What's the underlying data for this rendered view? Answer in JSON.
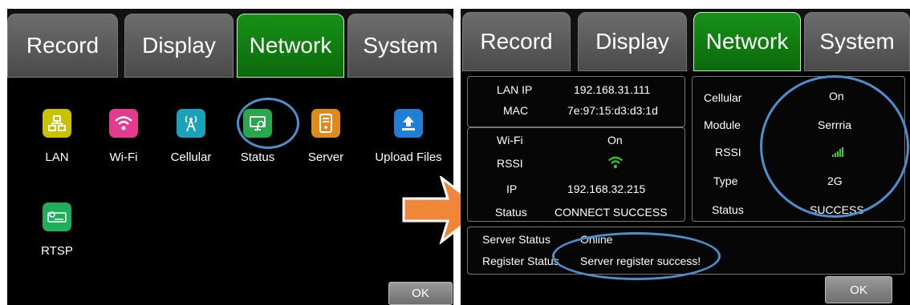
{
  "left_screen": {
    "tabs": [
      "Record",
      "Display",
      "Network",
      "System"
    ],
    "active_tab": "Network",
    "icons": [
      {
        "label": "LAN",
        "icon": "lan-icon",
        "color": "#c9c200"
      },
      {
        "label": "Wi-Fi",
        "icon": "wifi-icon",
        "color": "#e23b8f"
      },
      {
        "label": "Cellular",
        "icon": "cellular-antenna-icon",
        "color": "#1aa3b8"
      },
      {
        "label": "Status",
        "icon": "status-monitor-icon",
        "color": "#27a84a"
      },
      {
        "label": "Server",
        "icon": "server-icon",
        "color": "#e08a1e"
      },
      {
        "label": "Upload Files",
        "icon": "upload-icon",
        "color": "#1f7ed6"
      },
      {
        "label": "RTSP",
        "icon": "rtsp-camera-icon",
        "color": "#1fae5a"
      }
    ],
    "ok_label": "OK"
  },
  "right_screen": {
    "tabs": [
      "Record",
      "Display",
      "Network",
      "System"
    ],
    "active_tab": "Network",
    "lan": {
      "ip_label": "LAN IP",
      "ip_value": "192.168.31.111",
      "mac_label": "MAC",
      "mac_value": "7e:97:15:d3:d3:1d"
    },
    "wifi": {
      "wifi_label": "Wi-Fi",
      "wifi_value": "On",
      "rssi_label": "RSSI",
      "ip_label": "IP",
      "ip_value": "192.168.32.215",
      "status_label": "Status",
      "status_value": "CONNECT SUCCESS"
    },
    "cellular": {
      "cellular_label": "Cellular",
      "cellular_value": "On",
      "module_label": "Module",
      "module_value": "Serrria",
      "rssi_label": "RSSI",
      "type_label": "Type",
      "type_value": "2G",
      "status_label": "Status",
      "status_value": "SUCCESS"
    },
    "server": {
      "server_status_label": "Server Status",
      "server_status_value": "Online",
      "register_status_label": "Register Status",
      "register_status_value": "Server register success!"
    },
    "ok_label": "OK"
  },
  "colors": {
    "active_tab": "#0f7d0f",
    "highlight": "#4c8fce",
    "arrow": "#f0863a",
    "signal": "#2fd12f"
  }
}
